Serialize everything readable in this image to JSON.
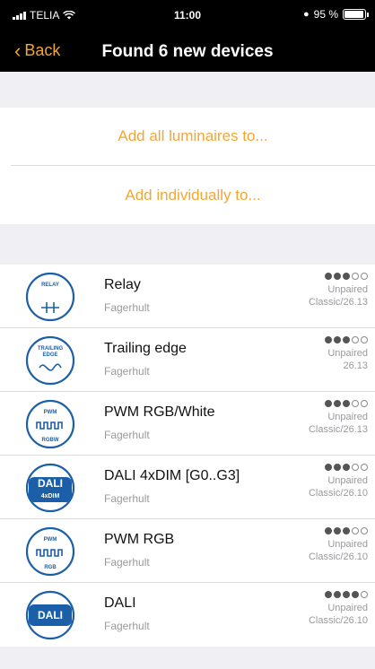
{
  "status_bar": {
    "carrier": "TELIA",
    "time": "11:00",
    "battery": "95 %",
    "battery_level": 0.95
  },
  "nav": {
    "back_label": "Back",
    "title": "Found 6 new devices"
  },
  "actions": {
    "add_all": "Add all luminaires to...",
    "add_individually": "Add individually to..."
  },
  "colors": {
    "accent": "#f3a634",
    "icon_blue": "#1b5fa9"
  },
  "devices": [
    {
      "name": "Relay",
      "maker": "Fagerhult",
      "status": "Unpaired",
      "version": "Classic/26.13",
      "signal_filled": 3,
      "signal_total": 5,
      "icon": "relay-icon",
      "icon_label_top": "RELAY",
      "icon_label_bottom": ""
    },
    {
      "name": "Trailing edge",
      "maker": "Fagerhult",
      "status": "Unpaired",
      "version": "26.13",
      "signal_filled": 3,
      "signal_total": 5,
      "icon": "trailing-edge-icon",
      "icon_label_top": "TRAILING",
      "icon_label_bottom": "EDGE"
    },
    {
      "name": "PWM RGB/White",
      "maker": "Fagerhult",
      "status": "Unpaired",
      "version": "Classic/26.13",
      "signal_filled": 3,
      "signal_total": 5,
      "icon": "pwm-rgbw-icon",
      "icon_label_top": "PWM",
      "icon_label_bottom": "RGBW"
    },
    {
      "name": "DALI 4xDIM [G0..G3]",
      "maker": "Fagerhult",
      "status": "Unpaired",
      "version": "Classic/26.10",
      "signal_filled": 3,
      "signal_total": 5,
      "icon": "dali-4xdim-icon",
      "icon_label_top": "DALI",
      "icon_label_bottom": "4xDIM"
    },
    {
      "name": "PWM RGB",
      "maker": "Fagerhult",
      "status": "Unpaired",
      "version": "Classic/26.10",
      "signal_filled": 3,
      "signal_total": 5,
      "icon": "pwm-rgb-icon",
      "icon_label_top": "PWM",
      "icon_label_bottom": "RGB"
    },
    {
      "name": "DALI",
      "maker": "Fagerhult",
      "status": "Unpaired",
      "version": "Classic/26.10",
      "signal_filled": 4,
      "signal_total": 5,
      "icon": "dali-icon",
      "icon_label_top": "DALI",
      "icon_label_bottom": ""
    }
  ]
}
